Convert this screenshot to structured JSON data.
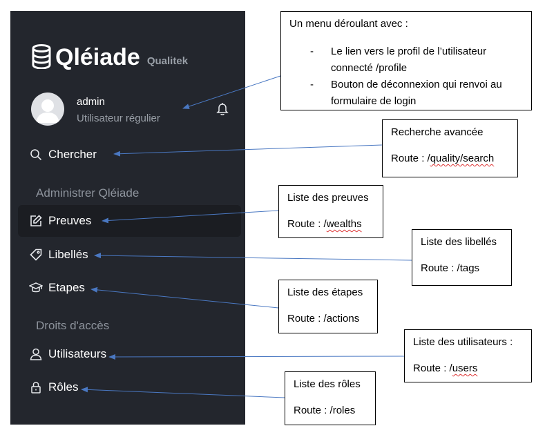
{
  "sidebar": {
    "brand": {
      "name": "Qléiade",
      "sub": "Qualitek"
    },
    "user": {
      "name": "admin",
      "role": "Utilisateur régulier",
      "icon": "bell-icon"
    },
    "search": {
      "label": "Chercher",
      "icon": "search-icon"
    },
    "sections": [
      {
        "title": "Administrer Qléiade"
      },
      {
        "title": "Droits d'accès"
      }
    ],
    "items": [
      {
        "label": "Preuves",
        "icon": "edit-icon",
        "active": true
      },
      {
        "label": "Libellés",
        "icon": "tag-icon"
      },
      {
        "label": "Etapes",
        "icon": "graduation-cap-icon"
      },
      {
        "label": "Utilisateurs",
        "icon": "user-icon"
      },
      {
        "label": "Rôles",
        "icon": "lock-icon"
      }
    ]
  },
  "callouts": {
    "menu": {
      "title": "Un menu déroulant avec :",
      "bullets": [
        "Le lien vers le profil de l’utilisateur connecté /profile",
        "Bouton de déconnexion qui renvoi au formulaire de login"
      ]
    },
    "search": {
      "title": "Recherche avancée",
      "route_prefix": "Route : /",
      "route": "quality/search"
    },
    "preuves": {
      "title": "Liste des preuves",
      "route_prefix": "Route : /",
      "route": "wealths"
    },
    "libelles": {
      "title": "Liste des libellés",
      "route_prefix": "Route : /",
      "route": "tags"
    },
    "etapes": {
      "title": "Liste des étapes",
      "route_prefix": "Route : /",
      "route": "actions"
    },
    "utilisateurs": {
      "title": "Liste des utilisateurs :",
      "route_prefix": "Route : /",
      "route": "users"
    },
    "roles": {
      "title": "Liste des rôles",
      "route_prefix": "Route : /",
      "route": "roles"
    }
  },
  "colors": {
    "sidebar_bg": "#23262d",
    "arrow": "#4a78c2"
  }
}
